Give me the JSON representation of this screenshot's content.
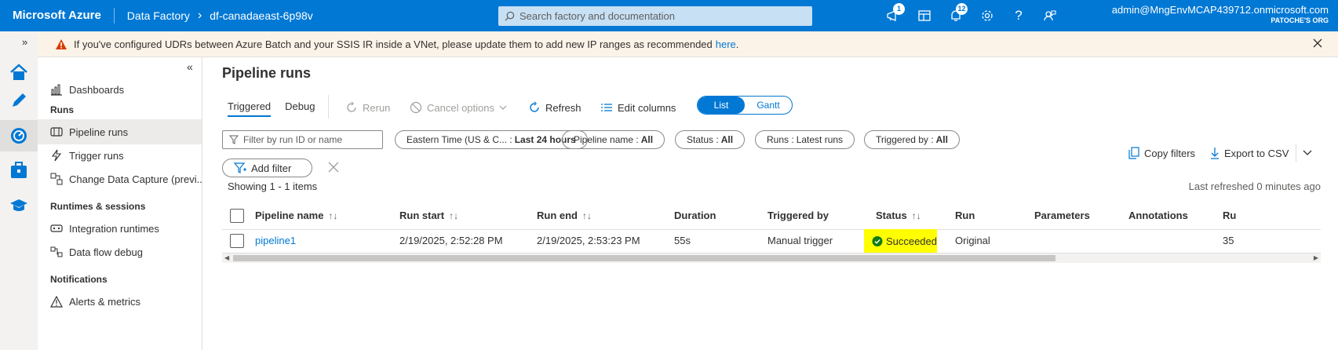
{
  "header": {
    "brand": "Microsoft Azure",
    "product": "Data Factory",
    "factory_name": "df-canadaeast-6p98v",
    "search_placeholder": "Search factory and documentation",
    "notifications_count": "1",
    "alerts_count": "12",
    "account_email": "admin@MngEnvMCAP439712.onmicrosoft.com",
    "account_org": "PATOCHE'S ORG",
    "icons": [
      "notification-icon",
      "switch-directory-icon",
      "bell-icon",
      "settings-icon",
      "help-icon",
      "feedback-icon"
    ]
  },
  "banner": {
    "message": "If you've configured UDRs between Azure Batch and your SSIS IR inside a VNet, please update them to add new IP ranges as recommended",
    "link_text": "here",
    "suffix": "."
  },
  "rail": [
    "home-icon",
    "author-icon",
    "monitor-icon",
    "manage-icon",
    "learning-icon"
  ],
  "sidenav": {
    "dashboards": "Dashboards",
    "runs_header": "Runs",
    "pipeline_runs": "Pipeline runs",
    "trigger_runs": "Trigger runs",
    "change_data_capture": "Change Data Capture (previ...",
    "runtimes_header": "Runtimes & sessions",
    "integration_runtimes": "Integration runtimes",
    "data_flow_debug": "Data flow debug",
    "notifications_header": "Notifications",
    "alerts_metrics": "Alerts & metrics"
  },
  "main": {
    "title": "Pipeline runs",
    "tabs": [
      "Triggered",
      "Debug"
    ],
    "toolbar": {
      "rerun": "Rerun",
      "cancel_options": "Cancel options",
      "refresh": "Refresh",
      "edit_columns": "Edit columns",
      "view_list": "List",
      "view_gantt": "Gantt"
    },
    "filters": {
      "search_placeholder": "Filter by run ID or name",
      "time_label": "Eastern Time (US & C... :",
      "time_value": "Last 24 hours",
      "pipeline_label": "Pipeline name :",
      "pipeline_value": "All",
      "status_label": "Status :",
      "status_value": "All",
      "runs_label": "Runs :",
      "runs_value": "Latest runs",
      "triggered_label": "Triggered by :",
      "triggered_value": "All",
      "add_filter": "Add filter",
      "copy_filters": "Copy filters",
      "export_csv": "Export to CSV"
    },
    "showing": "Showing 1 - 1 items",
    "last_refreshed": "Last refreshed 0 minutes ago",
    "table": {
      "columns": [
        "Pipeline name",
        "Run start",
        "Run end",
        "Duration",
        "Triggered by",
        "Status",
        "Run",
        "Parameters",
        "Annotations",
        "Ru"
      ],
      "rows": [
        {
          "pipeline_name": "pipeline1",
          "run_start": "2/19/2025, 2:52:28 PM",
          "run_end": "2/19/2025, 2:53:23 PM",
          "duration": "55s",
          "triggered_by": "Manual trigger",
          "status": "Succeeded",
          "run": "Original",
          "parameters": "",
          "annotations": "",
          "run_id_partial": "35"
        }
      ]
    }
  },
  "colors": {
    "accent": "#0078d4",
    "status_highlight": "#ffff00",
    "success": "#107c10",
    "warning": "#d83b01"
  }
}
